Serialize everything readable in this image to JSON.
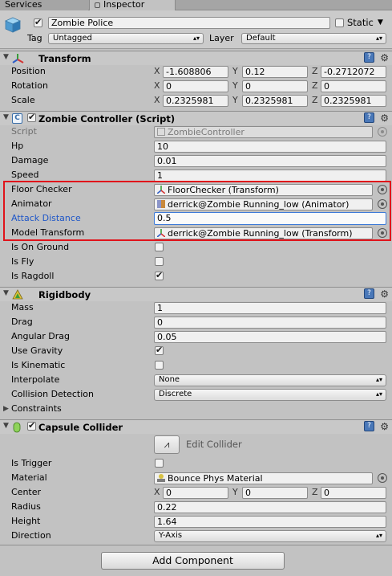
{
  "tabs": {
    "services": "Services",
    "inspector": "Inspector"
  },
  "header": {
    "object_name": "Zombie Police",
    "static_label": "Static",
    "tag_label": "Tag",
    "tag_value": "Untagged",
    "layer_label": "Layer",
    "layer_value": "Default"
  },
  "transform": {
    "title": "Transform",
    "rows": [
      {
        "label": "Position",
        "x": "-1.608806",
        "y": "0.12",
        "z": "-0.2712072"
      },
      {
        "label": "Rotation",
        "x": "0",
        "y": "0",
        "z": "0"
      },
      {
        "label": "Scale",
        "x": "0.2325981",
        "y": "0.2325981",
        "z": "0.2325981"
      }
    ],
    "axis": {
      "x": "X",
      "y": "Y",
      "z": "Z"
    }
  },
  "zombie_controller": {
    "title": "Zombie Controller (Script)",
    "script_label": "Script",
    "script_value": "ZombieController",
    "hp_label": "Hp",
    "hp_value": "10",
    "damage_label": "Damage",
    "damage_value": "0.01",
    "speed_label": "Speed",
    "speed_value": "1",
    "floor_checker_label": "Floor Checker",
    "floor_checker_value": "FloorChecker (Transform)",
    "animator_label": "Animator",
    "animator_value": "derrick@Zombie Running_low (Animator)",
    "attack_distance_label": "Attack Distance",
    "attack_distance_value": "0.5",
    "model_transform_label": "Model Transform",
    "model_transform_value": "derrick@Zombie Running_low (Transform)",
    "is_on_ground_label": "Is On Ground",
    "is_fly_label": "Is Fly",
    "is_ragdoll_label": "Is Ragdoll"
  },
  "rigidbody": {
    "title": "Rigidbody",
    "mass_label": "Mass",
    "mass_value": "1",
    "drag_label": "Drag",
    "drag_value": "0",
    "angular_drag_label": "Angular Drag",
    "angular_drag_value": "0.05",
    "use_gravity_label": "Use Gravity",
    "is_kinematic_label": "Is Kinematic",
    "interpolate_label": "Interpolate",
    "interpolate_value": "None",
    "collision_label": "Collision Detection",
    "collision_value": "Discrete",
    "constraints_label": "Constraints"
  },
  "capsule": {
    "title": "Capsule Collider",
    "edit_collider": "Edit Collider",
    "is_trigger_label": "Is Trigger",
    "material_label": "Material",
    "material_value": "Bounce Phys Material",
    "center_label": "Center",
    "center_x": "0",
    "center_y": "0",
    "center_z": "0",
    "radius_label": "Radius",
    "radius_value": "0.22",
    "height_label": "Height",
    "height_value": "1.64",
    "direction_label": "Direction",
    "direction_value": "Y-Axis"
  },
  "add_component": "Add Component",
  "colors": {
    "highlight_box": "#e0141b",
    "blue_label": "#1f57c8",
    "panel_bg": "#c2c2c2"
  }
}
